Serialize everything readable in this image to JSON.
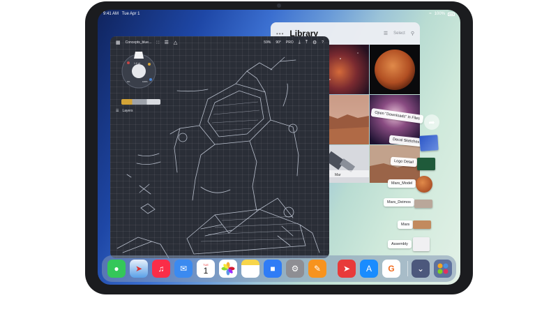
{
  "status_bar": {
    "time": "9:41 AM",
    "date": "Tue Apr 1",
    "battery": "100%"
  },
  "concepts": {
    "doc_title": "Concepts_blue...",
    "zoom": "59%",
    "angle": "90°",
    "pro_label": "PRO",
    "help": "?",
    "layers_label": "Layers",
    "wheel_size": "1.0 pt",
    "wheel_opacity": "0%",
    "wheel_smoothing": "100%"
  },
  "library": {
    "title": "Library",
    "select_label": "Select"
  },
  "drag_stack": {
    "open_in_files": "Open \"Downloads\" in Files",
    "items": [
      "Decal Sketches",
      "Logo Detail",
      "Mars_Model",
      "Mars_Deimos",
      "Mars",
      "Assembly"
    ],
    "partial_label": "Mar"
  },
  "dock": {
    "apps": [
      "Messages",
      "Safari",
      "Music",
      "Mail",
      "Calendar",
      "Photos",
      "Notes",
      "Files",
      "Settings",
      "Concepts",
      "Spark",
      "App Store",
      "Glimpse",
      "Downloads",
      "App Library"
    ],
    "calendar_day": "TUE",
    "calendar_date": "1"
  },
  "colors": {
    "accent_yellow": "#d4a437",
    "canvas": "#2a2e37"
  }
}
